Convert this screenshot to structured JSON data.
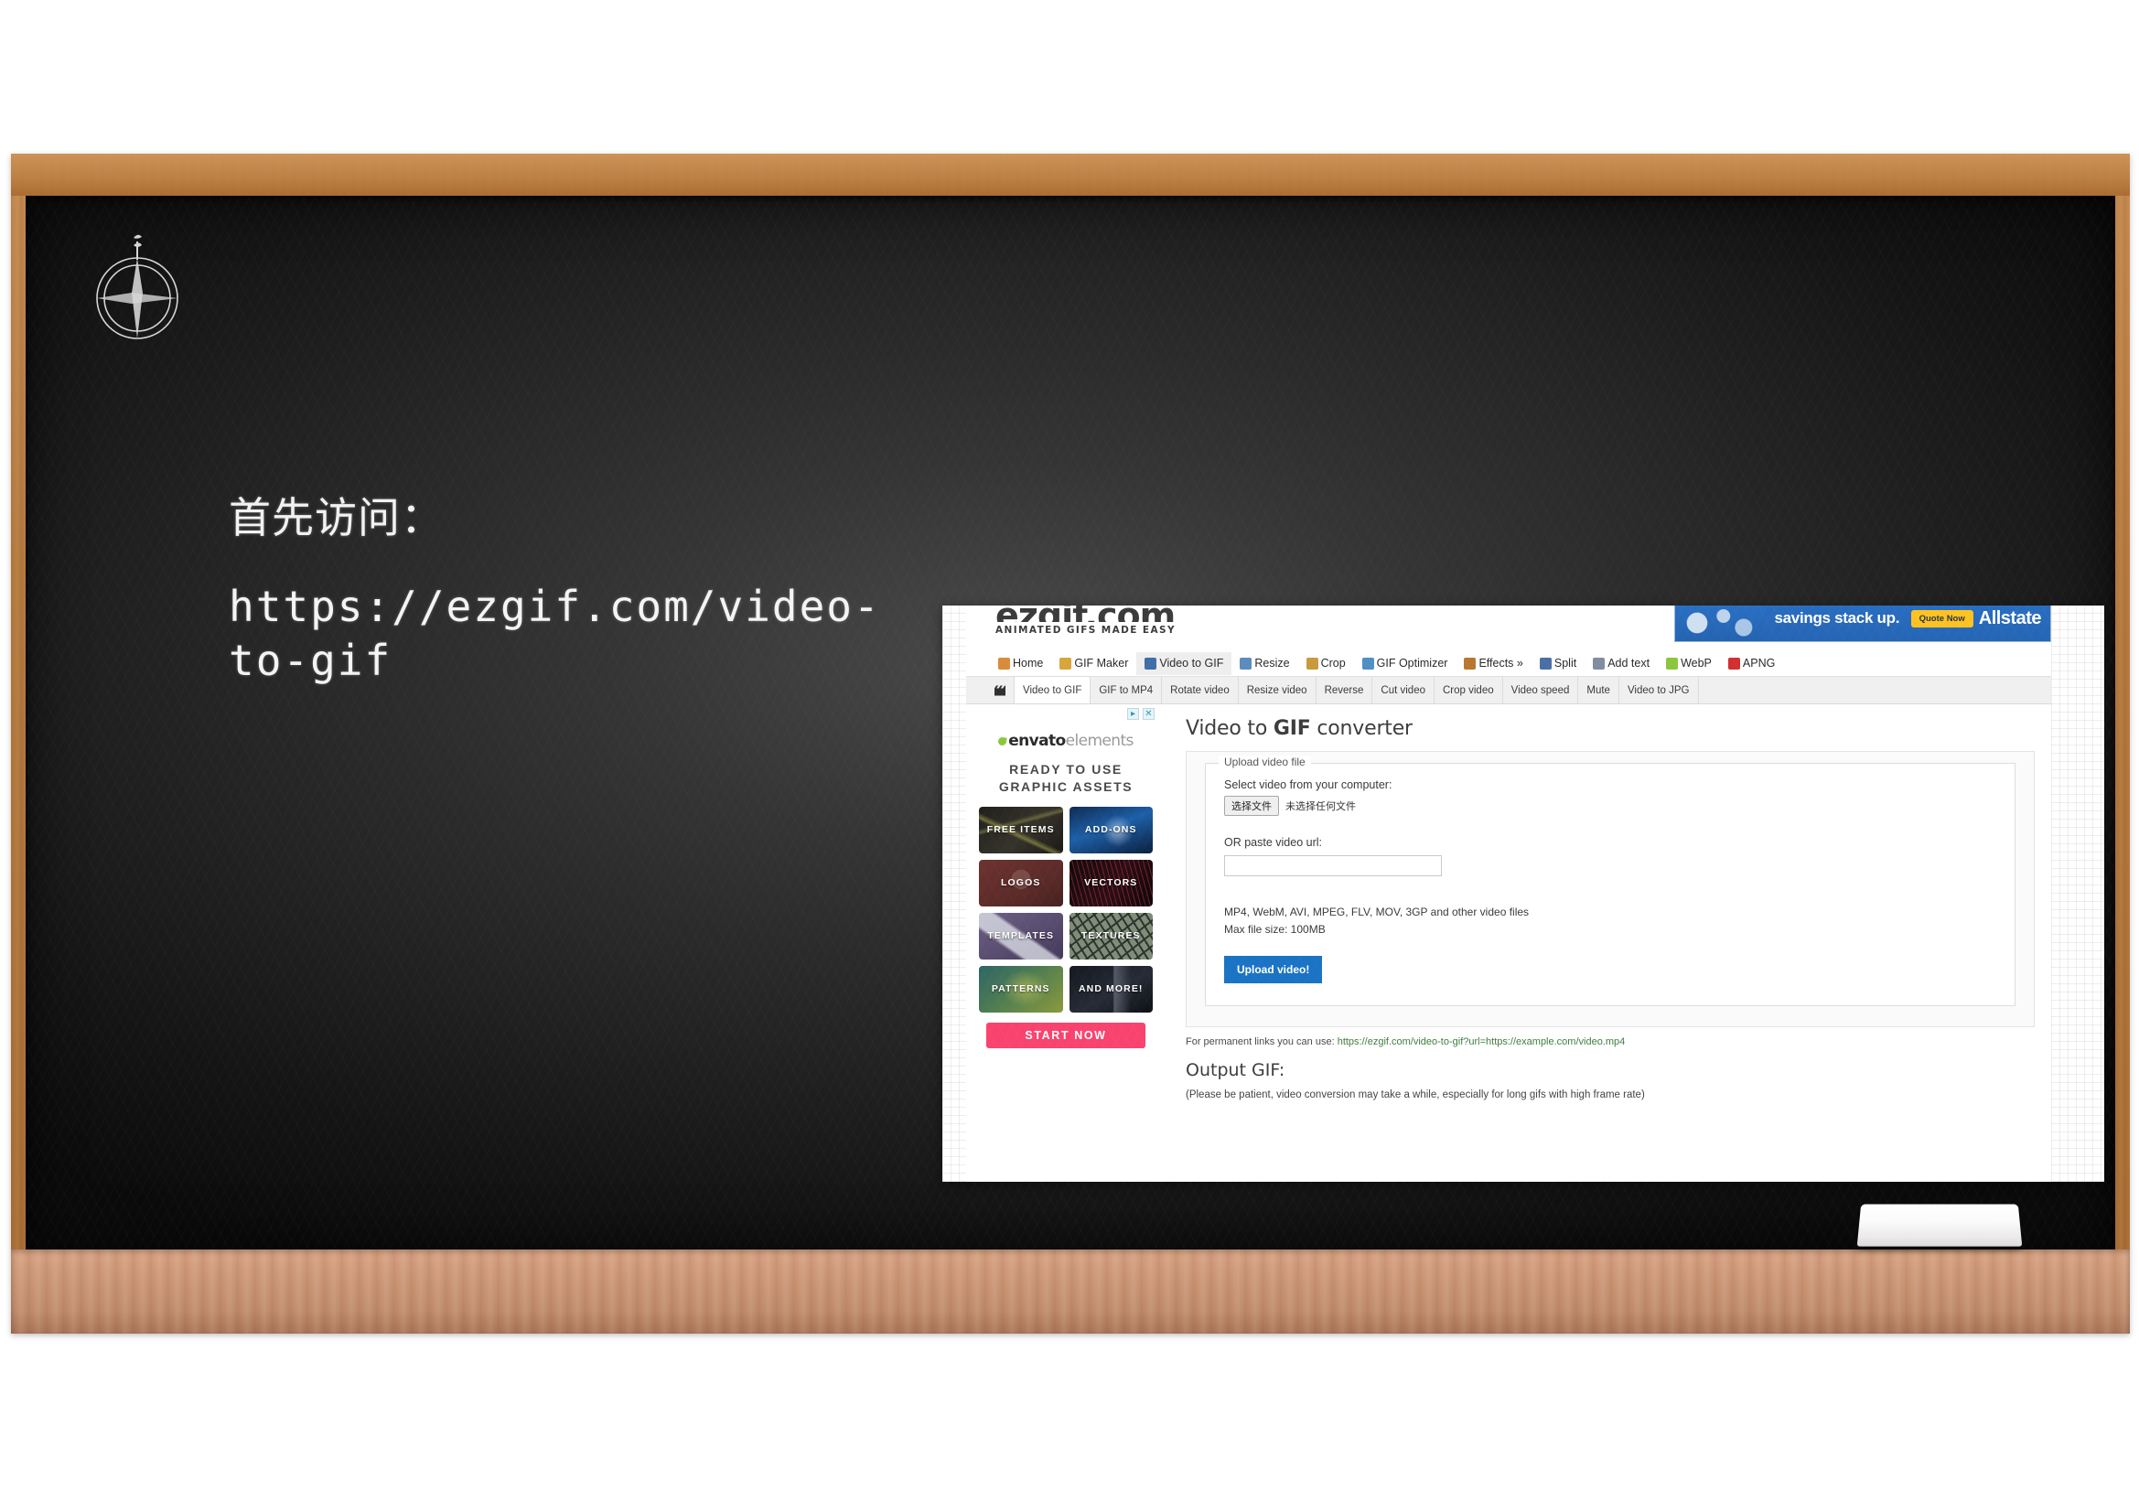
{
  "slide": {
    "heading": "首先访问：",
    "url_text": "https://ezgif.com/video-to-gif",
    "compass_name": "compass-rose-chalk-drawing",
    "eraser_name": "chalk-eraser"
  },
  "screenshot": {
    "logo": {
      "wordmark": "ezgif.com",
      "tagline": "ANIMATED GIFS MADE EASY"
    },
    "banner_ad": {
      "text": "savings stack up.",
      "cta": "Quote Now",
      "brand": "Allstate",
      "bg_color": "#2565b4",
      "cta_color": "#ffc220"
    },
    "main_nav": [
      {
        "label": "Home",
        "icon": "home-icon",
        "color": "#d98b3a",
        "active": false
      },
      {
        "label": "GIF Maker",
        "icon": "gif-maker-icon",
        "color": "#d8a53c",
        "active": false
      },
      {
        "label": "Video to GIF",
        "icon": "video-icon",
        "color": "#3f6ea8",
        "active": true
      },
      {
        "label": "Resize",
        "icon": "resize-icon",
        "color": "#5b8bbf",
        "active": false
      },
      {
        "label": "Crop",
        "icon": "crop-icon",
        "color": "#c89a3e",
        "active": false
      },
      {
        "label": "GIF Optimizer",
        "icon": "optimizer-icon",
        "color": "#4f8fc4",
        "active": false
      },
      {
        "label": "Effects »",
        "icon": "effects-icon",
        "color": "#b8772f",
        "active": false
      },
      {
        "label": "Split",
        "icon": "split-icon",
        "color": "#4a6fa5",
        "active": false
      },
      {
        "label": "Add text",
        "icon": "add-text-icon",
        "color": "#7e8da0",
        "active": false
      },
      {
        "label": "WebP",
        "icon": "webp-icon",
        "color": "#8cc63e",
        "active": false
      },
      {
        "label": "APNG",
        "icon": "apng-icon",
        "color": "#d32f2f",
        "active": false
      }
    ],
    "sub_nav": {
      "icon": "clapperboard-icon",
      "items": [
        {
          "label": "Video to GIF",
          "active": true
        },
        {
          "label": "GIF to MP4",
          "active": false
        },
        {
          "label": "Rotate video",
          "active": false
        },
        {
          "label": "Resize video",
          "active": false
        },
        {
          "label": "Reverse",
          "active": false
        },
        {
          "label": "Cut video",
          "active": false
        },
        {
          "label": "Crop video",
          "active": false
        },
        {
          "label": "Video speed",
          "active": false
        },
        {
          "label": "Mute",
          "active": false
        },
        {
          "label": "Video to JPG",
          "active": false
        }
      ]
    },
    "sidebar_ad": {
      "adchoices_icon": "adchoices-icon",
      "close_icon": "close-icon",
      "brand_bold": "envato",
      "brand_light": "elements",
      "headline_line1": "READY TO USE",
      "headline_line2": "GRAPHIC ASSETS",
      "tiles": [
        {
          "label": "FREE ITEMS",
          "cls": "t-free"
        },
        {
          "label": "ADD-ONS",
          "cls": "t-addons"
        },
        {
          "label": "LOGOS",
          "cls": "t-logos"
        },
        {
          "label": "VECTORS",
          "cls": "t-vectors"
        },
        {
          "label": "TEMPLATES",
          "cls": "t-templates"
        },
        {
          "label": "TEXTURES",
          "cls": "t-textures"
        },
        {
          "label": "PATTERNS",
          "cls": "t-patterns"
        },
        {
          "label": "AND MORE!",
          "cls": "t-more"
        }
      ],
      "cta": "START NOW",
      "cta_color": "#f9436f"
    },
    "converter": {
      "title_part1": "Video to ",
      "title_bold": "GIF",
      "title_part2": " converter",
      "fieldset_legend": "Upload video file",
      "select_label": "Select video from your computer:",
      "file_button": "选择文件",
      "file_status": "未选择任何文件",
      "url_label": "OR paste video url:",
      "url_value": "",
      "url_placeholder": "",
      "formats_line1": "MP4, WebM, AVI, MPEG, FLV, MOV, 3GP and other video files",
      "formats_line2": "Max file size: 100MB",
      "upload_button": "Upload video!",
      "upload_button_color": "#1a73c4",
      "permalink_prefix": "For permanent links you can use: ",
      "permalink_url": "https://ezgif.com/video-to-gif?url=https://example.com/video.mp4",
      "output_title": "Output GIF:",
      "output_note": "(Please be patient, video conversion may take a while, especially for long gifs with high frame rate)"
    }
  }
}
